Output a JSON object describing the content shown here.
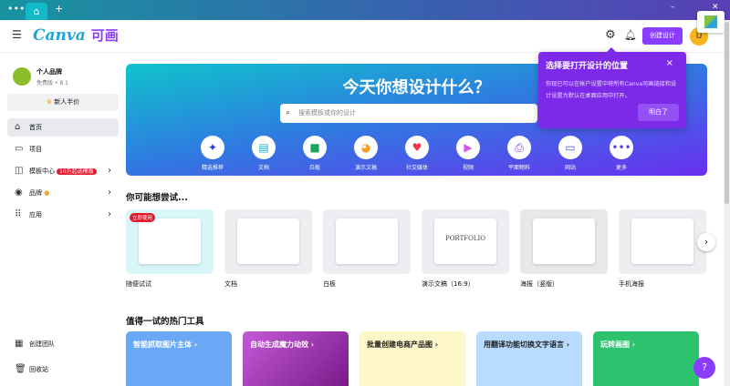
{
  "tabbar": {
    "menu": "•••",
    "home": "⌂",
    "new_tab": "+",
    "minimize": "–",
    "maximize": "❐",
    "close": "✕"
  },
  "header": {
    "brand": "Canva",
    "brand_cn": "可画",
    "create_button": "创建设计",
    "avatar_letter": "U"
  },
  "sidebar": {
    "team_name": "个人品牌",
    "team_sub": "免费版 • 8 1",
    "promo": "新人半价",
    "items": [
      {
        "label": "首页",
        "icon": "⌂"
      },
      {
        "label": "项目",
        "icon": "▭"
      },
      {
        "label": "模板中心",
        "icon": "◫",
        "badge": "10万起选模板"
      },
      {
        "label": "品牌",
        "icon": "◉"
      },
      {
        "label": "应用",
        "icon": "⠿"
      }
    ],
    "bottom": [
      {
        "label": "创建团队",
        "icon": "▦"
      },
      {
        "label": "回收站",
        "icon": "🗑"
      }
    ]
  },
  "banner": {
    "title": "今天你想设计什么？",
    "search_placeholder": "搜索模板或你的设计",
    "categories": [
      {
        "label": "精选推荐",
        "icon": "✦",
        "color": "#2c3df0"
      },
      {
        "label": "文档",
        "icon": "▤",
        "color": "#13b5c8"
      },
      {
        "label": "白板",
        "icon": "■",
        "color": "#1aa55a"
      },
      {
        "label": "演示文稿",
        "icon": "◕",
        "color": "#ff9a1a"
      },
      {
        "label": "社交媒体",
        "icon": "♥",
        "color": "#f0354a"
      },
      {
        "label": "视频",
        "icon": "▶",
        "color": "#d258e8"
      },
      {
        "label": "平面物料",
        "icon": "⎙",
        "color": "#8b3dff"
      },
      {
        "label": "网站",
        "icon": "▭",
        "color": "#4a55e8"
      },
      {
        "label": "更多",
        "icon": "•••",
        "color": "#5a3fe0"
      }
    ]
  },
  "try": {
    "title": "你可能想尝试...",
    "cards": [
      {
        "label": "随便试试",
        "tag": "立即使用"
      },
      {
        "label": "文档"
      },
      {
        "label": "白板"
      },
      {
        "label": "演示文稿（16:9）",
        "thumb_text": "PORTFOLIO"
      },
      {
        "label": "海报（竖版）"
      },
      {
        "label": "手机海报"
      }
    ]
  },
  "tools": {
    "title": "值得一试的热门工具",
    "cards": [
      {
        "label": "智能抓取图片主体 ›"
      },
      {
        "label": "自动生成魔力动效 ›"
      },
      {
        "label": "批量创建电商产品图 ›"
      },
      {
        "label": "用翻译功能切换文字语言 ›"
      },
      {
        "label": "玩转画图 ›"
      }
    ]
  },
  "tooltip": {
    "title": "选择要打开设计的位置",
    "body": "你现已可以在帐户设置中将所有Canva可画链接和设计设置为默认在桌面应用中打开。",
    "ok": "明白了",
    "close": "×"
  },
  "help": "?"
}
